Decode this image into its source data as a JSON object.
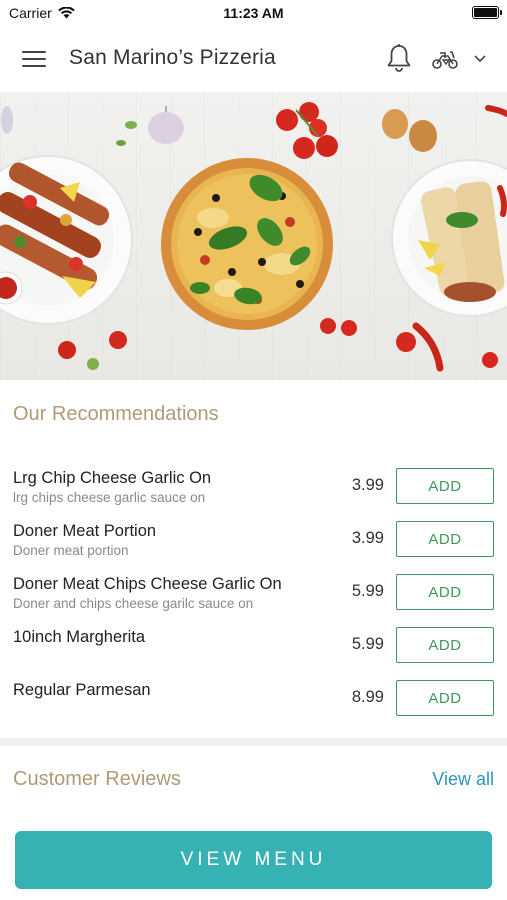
{
  "status_bar": {
    "carrier": "Carrier",
    "time": "11:23 AM"
  },
  "header": {
    "title": "San Marino’s Pizzeria",
    "icons": [
      "menu-icon",
      "bell-icon",
      "scooter-icon",
      "chevron-down-icon"
    ]
  },
  "hero": {
    "image": "food-banner: kebab skewers, margherita pizza, wraps, tomatoes"
  },
  "recommendations": {
    "title": "Our Recommendations",
    "add_label": "ADD",
    "items": [
      {
        "name": "Lrg Chip Cheese Garlic On",
        "description": "lrg chips cheese garlic sauce on",
        "price": "3.99"
      },
      {
        "name": "Doner Meat Portion",
        "description": "Doner meat portion",
        "price": "3.99"
      },
      {
        "name": "Doner Meat Chips Cheese Garlic On",
        "description": "Doner and chips cheese garilc sauce on",
        "price": "5.99"
      },
      {
        "name": "10inch Margherita",
        "description": "",
        "price": "5.99"
      },
      {
        "name": "Regular Parmesan",
        "description": "",
        "price": "8.99"
      }
    ]
  },
  "reviews": {
    "title": "Customer Reviews",
    "view_all": "View all"
  },
  "footer": {
    "view_menu": "VIEW MENU"
  },
  "colors": {
    "accent_gold": "#b09a78",
    "add_green": "#3e9a5a",
    "link_blue": "#2b97b8",
    "button_teal": "#37b2b4"
  }
}
